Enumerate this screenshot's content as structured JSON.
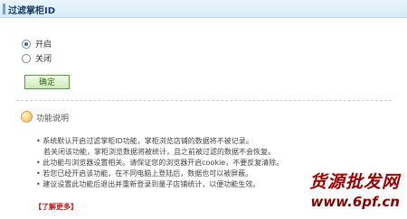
{
  "header": {
    "title": "过滤掌柜ID"
  },
  "options": [
    {
      "label": "开启",
      "checked": true
    },
    {
      "label": "关闭",
      "checked": false
    }
  ],
  "confirm_label": "确定",
  "info": {
    "title": "功能说明",
    "lines": [
      "• 系统默认开启过滤掌柜ID功能，掌柜浏览店铺的数据将不被记录。",
      "若关闭该功能，掌柜浏览数据将被统计，且之前被过滤的数据不会恢复。",
      "• 此功能与浏览器设置相关。请保证您的浏览器开启cookie，不要反复清除。",
      "• 若您已经开启该功能，在不同电脑上登陆后，数据也可以被屏蔽。",
      "• 建议设置此功能后退出并重新登录到量子店铺统计，以便功能生效。"
    ],
    "learn_more": "【了解更多】"
  },
  "watermark": {
    "text": "货源批发网",
    "url": "www.6pf.cn"
  }
}
